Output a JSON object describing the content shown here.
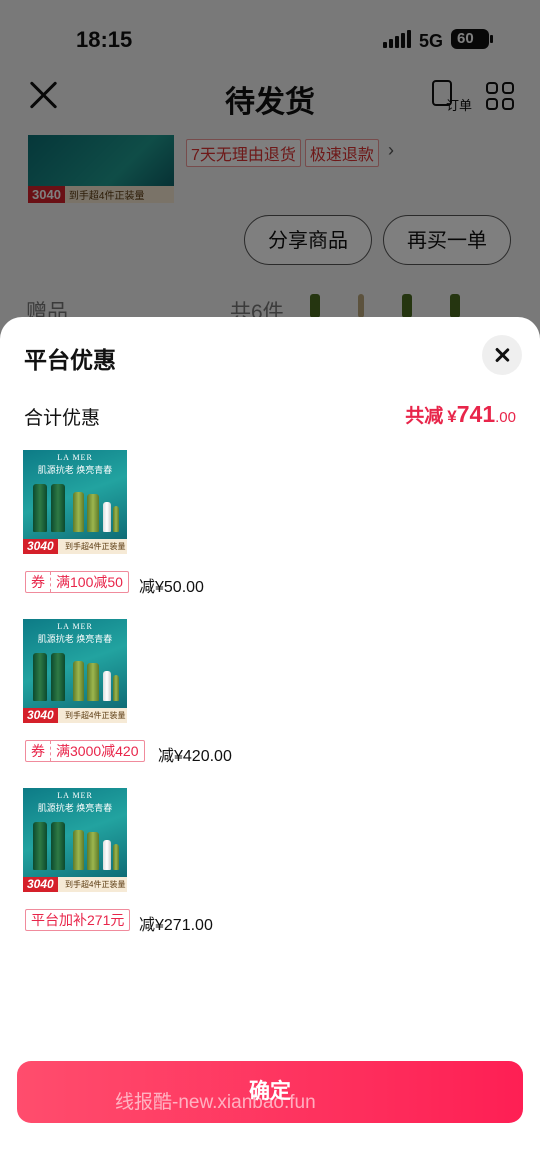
{
  "status_bar": {
    "time": "18:15",
    "network": "5G",
    "battery": "60"
  },
  "background_page": {
    "title": "待发货",
    "order_label": "订单",
    "product_price_badge": "3040",
    "product_price_note": "到手超4件正装量",
    "service_tags": [
      "7天无理由退货",
      "极速退款"
    ],
    "share_button": "分享商品",
    "rebuy_button": "再买一单",
    "gift_label": "赠品",
    "gift_count": "共6件"
  },
  "sheet": {
    "title": "平台优惠",
    "total_label": "合计优惠",
    "total_prefix": "共减",
    "total_currency": "¥",
    "total_integer": "741",
    "total_decimal": ".00",
    "items": [
      {
        "brand": "LA MER",
        "slogan": "肌源抗老 焕亮青春",
        "price_badge": "3040",
        "price_note": "到手超4件正装量",
        "coupon_type": "券",
        "coupon_text": "满100减50",
        "discount": "减¥50.00"
      },
      {
        "brand": "LA MER",
        "slogan": "肌源抗老 焕亮青春",
        "price_badge": "3040",
        "price_note": "到手超4件正装量",
        "coupon_type": "券",
        "coupon_text": "满3000减420",
        "discount": "减¥420.00"
      },
      {
        "brand": "LA MER",
        "slogan": "肌源抗老 焕亮青春",
        "price_badge": "3040",
        "price_note": "到手超4件正装量",
        "coupon_type": "",
        "coupon_text": "平台加补271元",
        "discount": "减¥271.00"
      }
    ],
    "confirm_button": "确定",
    "watermark": "线报酷-new.xianbao.fun"
  },
  "colors": {
    "accent": "#e8254a",
    "button_start": "#ff4d6d",
    "button_end": "#fe1f54"
  }
}
